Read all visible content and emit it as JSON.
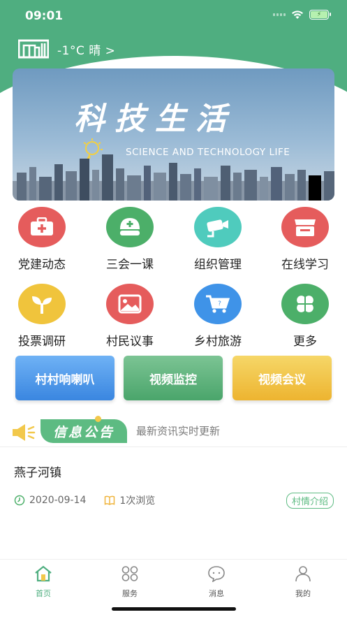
{
  "status_bar": {
    "time": "09:01"
  },
  "topbar": {
    "weather": "-1°C 晴 >"
  },
  "banner": {
    "title": "科技生活",
    "subtitle": "SCIENCE AND TECHNOLOGY LIFE"
  },
  "grid": [
    {
      "label": "党建动态",
      "icon": "medical-kit-icon",
      "color": "#e55c5c"
    },
    {
      "label": "三会一课",
      "icon": "nurse-cap-icon",
      "color": "#4caf69"
    },
    {
      "label": "组织管理",
      "icon": "video-camera-icon",
      "color": "#4fcbbd"
    },
    {
      "label": "在线学习",
      "icon": "store-icon",
      "color": "#e55c5c"
    },
    {
      "label": "投票调研",
      "icon": "sprout-icon",
      "color": "#f0c43c"
    },
    {
      "label": "村民议事",
      "icon": "picture-icon",
      "color": "#e55c5c"
    },
    {
      "label": "乡村旅游",
      "icon": "shopping-cart-icon",
      "color": "#3f93e8"
    },
    {
      "label": "更多",
      "icon": "clover-icon",
      "color": "#4caf69"
    }
  ],
  "buttons": {
    "broadcast": "村村响喇叭",
    "monitor": "视频监控",
    "meeting": "视频会议"
  },
  "notice": {
    "badge": "信息公告",
    "subtitle": "最新资讯实时更新"
  },
  "news": {
    "title": "燕子河镇",
    "date": "2020-09-14",
    "views": "1次浏览",
    "tag": "村情介绍"
  },
  "tabbar": [
    {
      "label": "首页",
      "icon": "home-icon",
      "active": true
    },
    {
      "label": "服务",
      "icon": "services-icon",
      "active": false
    },
    {
      "label": "消息",
      "icon": "message-icon",
      "active": false
    },
    {
      "label": "我的",
      "icon": "user-icon",
      "active": false
    }
  ],
  "colors": {
    "brand": "#4fae80",
    "accent": "#5dbb82"
  }
}
